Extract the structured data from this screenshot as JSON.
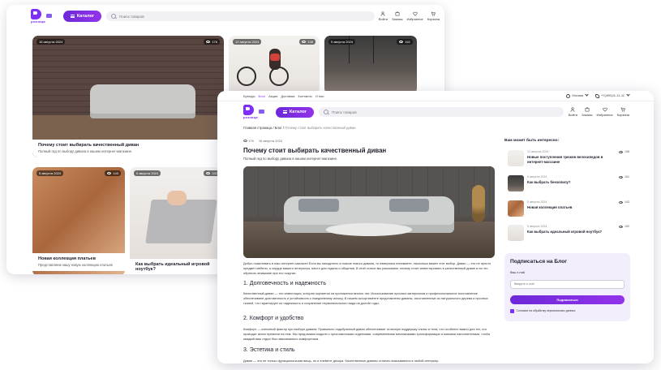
{
  "brand": {
    "logo_text": "розница",
    "accent": "#7b2ff7"
  },
  "header": {
    "catalog_label": "Каталог",
    "search_placeholder": "Поиск товаров",
    "icons": [
      {
        "name": "user-icon",
        "label": "Войти"
      },
      {
        "name": "orders-icon",
        "label": "Заказы"
      },
      {
        "name": "heart-icon",
        "label": "Избранное"
      },
      {
        "name": "cart-icon",
        "label": "Корзина"
      }
    ]
  },
  "back_cards": [
    {
      "date": "16 августа 2024",
      "views": "176",
      "title": "Почему стоит выбирать качественный диван",
      "subtitle": "Полный гид по выбору дивана в нашем интернет-магазине."
    },
    {
      "date": "12 августа 2024",
      "views": "138"
    },
    {
      "date": "9 августа 2024",
      "views": "161"
    },
    {
      "date": "5 августа 2024",
      "views": "143",
      "title": "Новая коллекция платьев",
      "subtitle": "Представляем нашу новую коллекцию платьев"
    },
    {
      "date": "5 августа 2024",
      "views": "152",
      "title": "Как выбрать идеальный игровой ноутбук?"
    }
  ],
  "topbar": {
    "links": [
      "Бренды",
      "Блог",
      "Акции",
      "Доставка",
      "Контакты",
      "О нас"
    ],
    "active": "Блог",
    "city": "Москва",
    "phone": "+7(495)11-11-11"
  },
  "breadcrumb": {
    "home": "Главная страница",
    "blog": "Блог",
    "current": "Почему стоит выбирать качественный диван"
  },
  "article": {
    "views": "176",
    "date": "16 августа 2024",
    "title": "Почему стоит выбирать качественный диван",
    "lead": "Полный гид по выбору дивана в нашем интернет-магазине.",
    "intro": "Добро пожаловать в наш интернет-магазин! Если вы находитесь в поиске нового дивана, то наверняка понимаете, насколько важен этот выбор. Диван — это не просто предмет мебели, а сердце вашего интерьера, место для отдыха и общения. В этой статье мы расскажем, почему стоит инвестировать в качественный диван и на что обратить внимание при его покупке.",
    "h1": "1. Долговечность и надежность",
    "p1": "Качественный диван — это инвестиция, которая окупается на протяжении многих лет. Использование прочных материалов и профессиональное изготовление обеспечивают долговечность и устойчивость к ежедневному износу. В нашем ассортименте представлены диваны, изготовленные из натурального дерева и прочных тканей, что гарантирует их надежность и сохранение первоначального вида на долгие годы.",
    "h2": "2. Комфорт и удобство",
    "p2": "Комфорт — ключевой фактор при выборе дивана. Правильно подобранный диван обеспечивает отличную поддержку спины и тела, что особенно важно для тех, кто проводит много времени на нем. Мы предлагаем модели с эргономичными сидениями, современными механизмами трансформации и мягкими наполнителями, чтобы каждый ваш отдых был максимально комфортным.",
    "h3": "3. Эстетика и стиль",
    "p3": "Диван — это не только функциональная вещь, но и элемент декора. Качественные диваны отлично вписываются в любой интерьер."
  },
  "sidebar": {
    "heading": "Вам может быть интересно:",
    "items": [
      {
        "date": "12 августа 2024",
        "views": "138",
        "title": "Новые поступления трюков велосипедов в интернет-магазине"
      },
      {
        "date": "9 августа 2024",
        "views": "161",
        "title": "Как выбрать бензопилу?"
      },
      {
        "date": "5 августа 2024",
        "views": "143",
        "title": "Новая коллекция платьев"
      },
      {
        "date": "5 августа 2024",
        "views": "152",
        "title": "Как выбрать идеальный игровой ноутбук?"
      }
    ]
  },
  "subscribe": {
    "heading": "Подписаться на Блог",
    "email_label": "Ваш e-mail",
    "email_placeholder": "Введите e-mail",
    "button": "Подписаться",
    "consent": "Согласие на обработку персональных данных"
  }
}
